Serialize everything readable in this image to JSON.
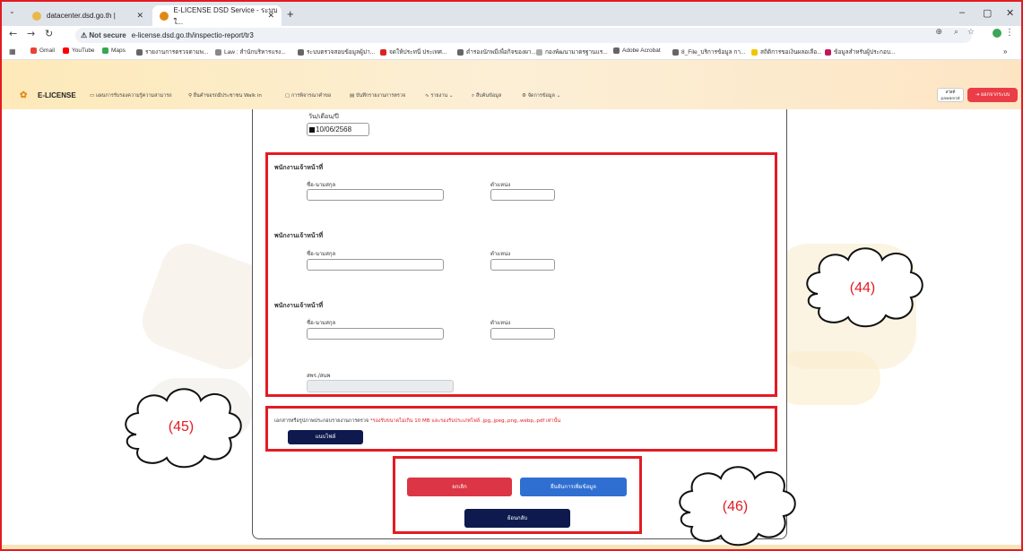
{
  "browser": {
    "tabs": [
      {
        "label": "datacenter.dsd.go.th |"
      },
      {
        "label": "E-LICENSE DSD Service - ระบบใ..."
      }
    ],
    "new_tab": "+",
    "address": {
      "security": "Not secure",
      "url": "e-license.dsd.go.th/inspectio-report/tr3"
    },
    "bookmarks": [
      "Gmail",
      "YouTube",
      "Maps",
      "รายงานการตรวจตามพ...",
      "Law : สำนักบริหารแรง...",
      "ระบบตรวจสอบข้อมูลผู้ม่า...",
      "จดให้ประทนี่ ประเทศ...",
      "ตำรองนักพมีเพื่อกิจของผา...",
      "กองพัฒนามาตรฐานแร...",
      "Adobe Acrobat",
      "8_File_บริการข้อมูล กา...",
      "สถิติการขอเงินผลอเลือ...",
      "ข้อมูลสำหรับผู้ประกอบ..."
    ],
    "bookmarks_more": "»"
  },
  "app": {
    "logo": "E-LICENSE",
    "nav": [
      "แผนการรับรองความรู้ความสามารถ",
      "ยื่นคำขอรถมีประชาชน Walk in",
      "การพิจารณาคำขอ",
      "บันทึกรายงานการตรวจ",
      "รายงาน",
      "สืบค้นข้อมูล",
      "จัดการข้อมูล"
    ],
    "user": {
      "line1": "สวัสดี",
      "line2": "pawanrat"
    },
    "logout": "ออกจากระบบ"
  },
  "form": {
    "date_label": "วัน/เดือน/ปี",
    "date_value": "10/06/2568",
    "officers": [
      {
        "heading": "พนักงานเจ้าหน้าที่",
        "name_label": "ชื่อ-นามสกุล",
        "position_label": "ตำแหน่ง"
      },
      {
        "heading": "พนักงานเจ้าหน้าที่",
        "name_label": "ชื่อ-นามสกุล",
        "position_label": "ตำแหน่ง"
      },
      {
        "heading": "พนักงานเจ้าหน้าที่",
        "name_label": "ชื่อ-นามสกุล",
        "position_label": "ตำแหน่ง"
      }
    ],
    "office_label": "สพร./สนพ",
    "attach_label": "เอกสารหรือรูปภาพประกอบรายงานการตรวจ",
    "attach_note": "*รองรับขนาดไม่เกิน 10 MB และรองรับประเภทไฟล์ .jpg,.jpeg,.png,.webp,.pdf เท่านั้น",
    "attach_button": "แนบไฟล์",
    "cancel_button": "ยกเลิก",
    "confirm_button": "ยืนยันการเพิ่มข้อมูล",
    "back_button": "ย้อนกลับ"
  },
  "annotations": {
    "c44": "(44)",
    "c45": "(45)",
    "c46": "(46)"
  },
  "colors": {
    "annotation": "#e31b23",
    "cancel": "#dc3545",
    "confirm": "#2f6fd1",
    "dark": "#0e1a4d"
  }
}
